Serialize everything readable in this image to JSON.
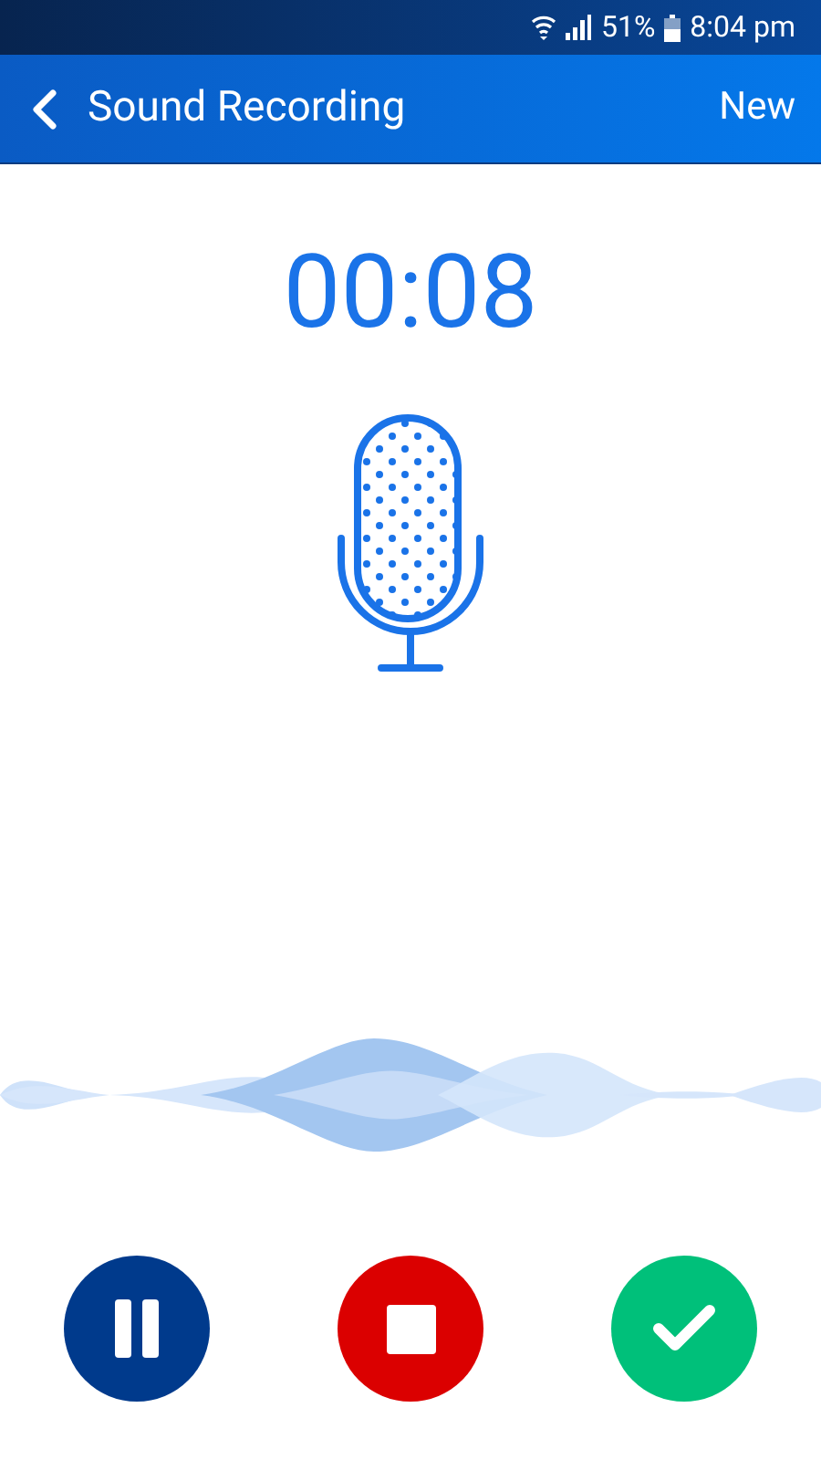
{
  "status_bar": {
    "battery": "51%",
    "time": "8:04 pm"
  },
  "header": {
    "title": "Sound Recording",
    "action": "New"
  },
  "timer": "00:08",
  "controls": [
    {
      "kind": "pause",
      "color": "#003a8c"
    },
    {
      "kind": "stop",
      "color": "#db0000"
    },
    {
      "kind": "done",
      "color": "#00c07a"
    }
  ]
}
